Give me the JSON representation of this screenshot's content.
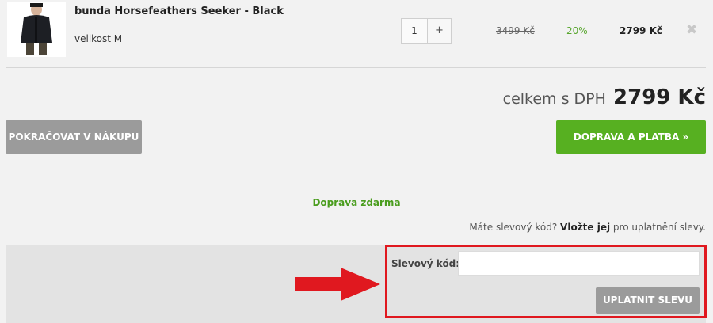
{
  "cart_item": {
    "name": "bunda Horsefeathers Seeker - Black",
    "variant": "velikost M",
    "quantity": "1",
    "quantity_plus": "+",
    "original_price": "3499 Kč",
    "discount": "20%",
    "price": "2799 Kč",
    "remove_symbol": "✖",
    "image_icon": "jacket-product-image"
  },
  "totals": {
    "label": "celkem s DPH",
    "value": "2799 Kč"
  },
  "buttons": {
    "continue_shopping": "POKRAČOVAT V NÁKUPU",
    "shipping_payment": "DOPRAVA A PLATBA »"
  },
  "shipping": {
    "free_shipping": "Doprava zdarma"
  },
  "coupon": {
    "question_prefix": "Máte slevový kód?",
    "question_link": "Vložte jej",
    "question_suffix": "pro uplatnění slevy.",
    "label": "Slevový kód:",
    "input_value": "",
    "apply_button": "UPLATNIT SLEVU"
  },
  "colors": {
    "accent_green": "#57b021",
    "highlight_red": "#e0181f",
    "button_gray": "#9b9b9b"
  }
}
